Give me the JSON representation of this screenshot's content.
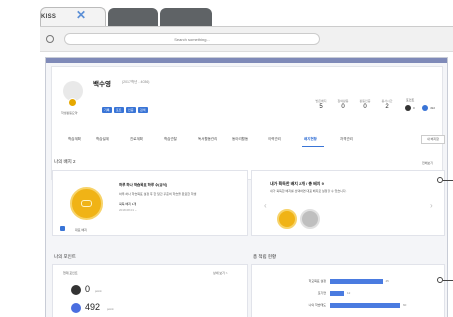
{
  "browser": {
    "brand": "KISS",
    "search_placeholder": "Search something..."
  },
  "profile": {
    "name": "백수영",
    "id": "(2017학년 - 4036)",
    "subtext": "학생활동요약",
    "tags": [
      "기록",
      "포트",
      "인증",
      "검색"
    ],
    "stats": [
      {
        "label": "받은배지",
        "value": "5"
      },
      {
        "label": "참여활동",
        "value": "0"
      },
      {
        "label": "활동인증",
        "value": "0"
      },
      {
        "label": "봉사시간",
        "value": "2"
      }
    ],
    "coins_label": "포인트",
    "coins": [
      {
        "label": "0",
        "color": "#333333"
      },
      {
        "label": "492",
        "color": "#3974d6"
      }
    ]
  },
  "nav": {
    "items": [
      "학습계획",
      "학습설계",
      "진로계획",
      "학습관찰",
      "독서활동관리",
      "동아리활동",
      "이력관리",
      "배지현황",
      "자격관리"
    ],
    "active_index": 7,
    "button": "내 배지함"
  },
  "badges_section": {
    "title": "나의 배지 2",
    "more": "전체보기",
    "left": {
      "title": "하루 하나 학습목표 하루 수(공식)",
      "desc": "하루 하나 학습목표 설정 후 한 달간 꾸준히 학습을 완료한 학생",
      "count": "획득 배지 1개",
      "date": "2018.08.01 ~",
      "checkbox_label": "대표 배지"
    },
    "right": {
      "title": "내가 획득한 배지 2개 / 총 배지 9",
      "desc": "내가 획득한 배지를 선택하면 대표 배지로 설정할 수 있습니다."
    }
  },
  "points_section": {
    "title": "나의 포인트",
    "subtitle": "현재 포인트",
    "link": "상세 보기 >",
    "rows": [
      {
        "value": "0",
        "unit": "point",
        "color": "#333333"
      },
      {
        "value": "492",
        "unit": "point",
        "color": "#4a6ee0"
      }
    ]
  },
  "activity_section": {
    "title": "총 적립 현황"
  },
  "chart_data": {
    "type": "bar",
    "categories": [
      "학교목표 설정",
      "포기연",
      "나의 학습태도"
    ],
    "values": [
      45,
      12,
      60
    ],
    "xlabel": "",
    "ylabel": ""
  }
}
